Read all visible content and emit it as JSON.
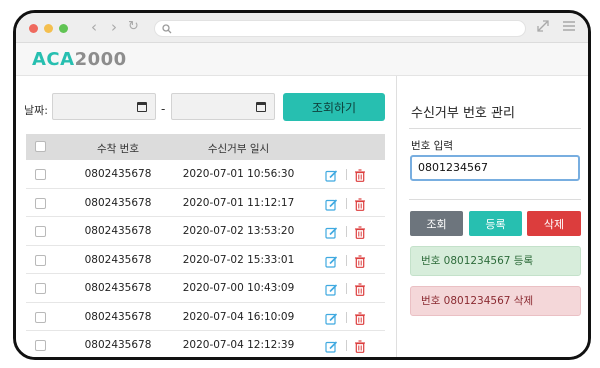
{
  "logo": {
    "part1": "ACA",
    "part2": "2000"
  },
  "filter": {
    "date_label": "날짜:",
    "range_separator": "-",
    "search_button": "조회하기"
  },
  "table": {
    "headers": {
      "number": "수착 번호",
      "datetime": "수신거부 일시"
    },
    "rows": [
      {
        "number": "0802435678",
        "datetime": "2020-07-01 10:56:30"
      },
      {
        "number": "0802435678",
        "datetime": "2020-07-01 11:12:17"
      },
      {
        "number": "0802435678",
        "datetime": "2020-07-02 13:53:20"
      },
      {
        "number": "0802435678",
        "datetime": "2020-07-02 15:33:01"
      },
      {
        "number": "0802435678",
        "datetime": "2020-07-00 10:43:09"
      },
      {
        "number": "0802435678",
        "datetime": "2020-07-04 16:10:09"
      },
      {
        "number": "0802435678",
        "datetime": "2020-07-04 12:12:39"
      }
    ]
  },
  "panel": {
    "title": "수신거부 번호 관리",
    "input_label": "번호 입력",
    "input_value": "0801234567",
    "buttons": {
      "query": "조회",
      "register": "등록",
      "delete": "삭제"
    },
    "messages": {
      "registered": "번호 0801234567 등록",
      "deleted": "번호 0801234567 삭제"
    }
  },
  "colors": {
    "accent": "#27bfb0",
    "danger": "#dc3d3d",
    "secondary": "#6d757d",
    "edit_icon": "#3fa9e0"
  },
  "icons": [
    "back-icon",
    "forward-icon",
    "reload-icon",
    "search-icon",
    "expand-icon",
    "menu-icon",
    "calendar-icon",
    "edit-icon",
    "trash-icon"
  ]
}
